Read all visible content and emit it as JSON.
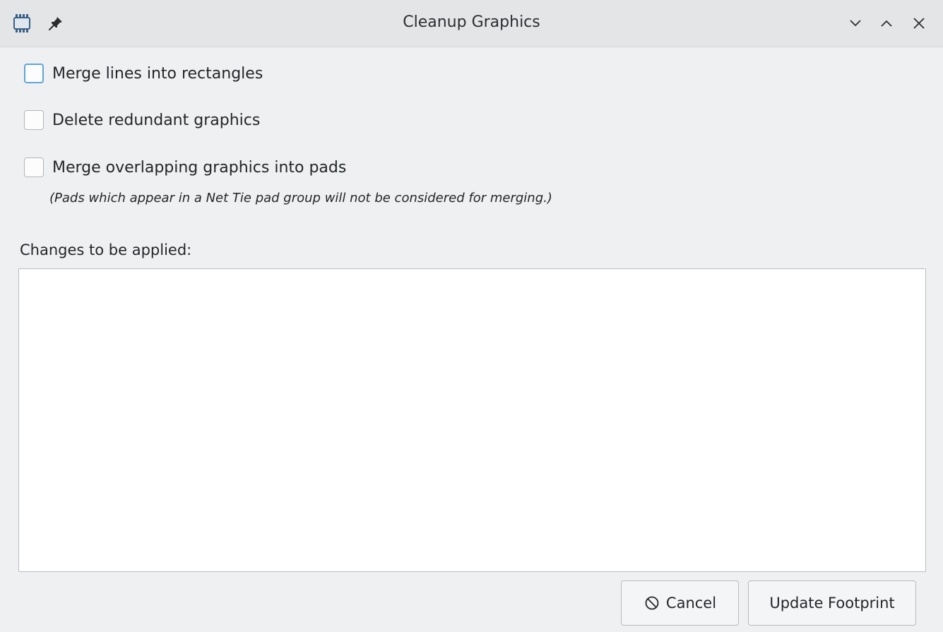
{
  "window": {
    "title": "Cleanup Graphics",
    "icons": {
      "app": "footprint-chip-icon",
      "pin": "pin-icon",
      "minimize": "chevron-down-icon",
      "maximize": "chevron-up-icon",
      "close": "close-icon"
    }
  },
  "options": [
    {
      "label": "Merge lines into rectangles",
      "checked": false
    },
    {
      "label": "Delete redundant graphics",
      "checked": false
    },
    {
      "label": "Merge overlapping graphics into pads",
      "checked": false
    }
  ],
  "note": "(Pads which appear in a Net Tie pad group will not be considered for merging.)",
  "changes": {
    "label": "Changes to be applied:",
    "items": []
  },
  "buttons": {
    "cancel": "Cancel",
    "cancel_icon": "cancel-circle-icon",
    "update": "Update Footprint"
  },
  "colors": {
    "focus": "#5fa6d9",
    "background": "#eff0f1"
  }
}
